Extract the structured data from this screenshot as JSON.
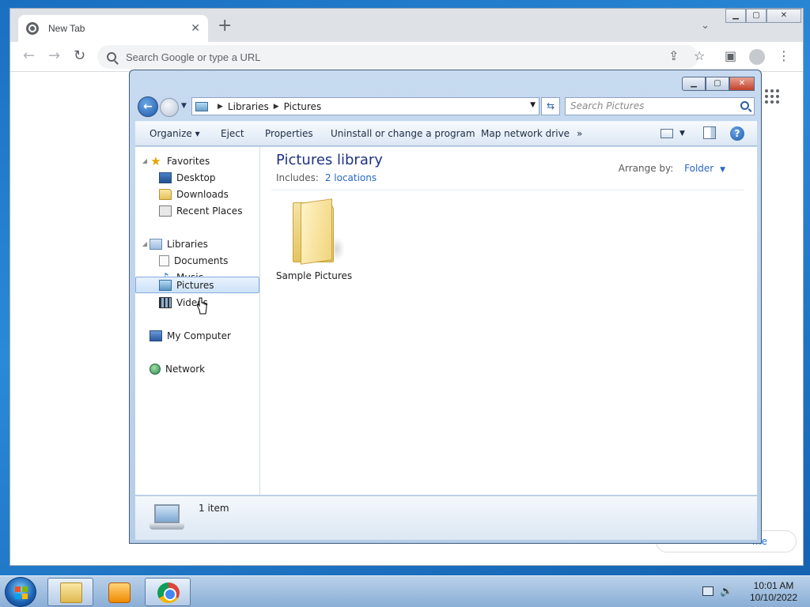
{
  "browser": {
    "tab_title": "New Tab",
    "tab_close": "✕",
    "new_tab": "+",
    "tab_search": "⌄",
    "omnibox_placeholder": "Search Google or type a URL",
    "back": "←",
    "forward": "→",
    "reload": "↻",
    "share": "⇪",
    "bookmark": "☆",
    "sidepanel": "▣",
    "menu": "⋮",
    "customize_fragment": "me",
    "window_controls": {
      "minimize": "▁",
      "maximize": "▢",
      "close": "✕"
    }
  },
  "explorer": {
    "window_controls": {
      "minimize": "▁",
      "maximize": "▢",
      "close": "✕"
    },
    "nav": {
      "back": "←",
      "history": "▼"
    },
    "breadcrumb": [
      "Libraries",
      "Pictures"
    ],
    "breadcrumb_sep": "▶",
    "address_dropdown": "▼",
    "refresh": "⇆",
    "search_placeholder": "Search Pictures",
    "command_bar": {
      "organize": "Organize ▾",
      "eject": "Eject",
      "properties": "Properties",
      "uninstall": "Uninstall or change a program",
      "map_drive": "Map network drive",
      "more": "»",
      "views_dropdown": "▼",
      "help": "?"
    },
    "nav_pane": {
      "favorites": "Favorites",
      "desktop": "Desktop",
      "downloads": "Downloads",
      "recent_places": "Recent Places",
      "libraries": "Libraries",
      "documents": "Documents",
      "music": "Music",
      "pictures": "Pictures",
      "videos": "Videos",
      "my_computer": "My Computer",
      "network": "Network"
    },
    "library": {
      "title": "Pictures library",
      "includes_label": "Includes:",
      "includes_link": "2 locations",
      "arrange_label": "Arrange by:",
      "arrange_value": "Folder",
      "arrange_dropdown": "▼"
    },
    "items": [
      {
        "name": "Sample Pictures"
      }
    ],
    "status": {
      "count": "1 item"
    }
  },
  "taskbar": {
    "time": "10:01 AM",
    "date": "10/10/2022",
    "volume_icon": "🔊"
  },
  "colors": {
    "library_title": "#1e3287",
    "link": "#2767c9",
    "selection_border": "#84acdd"
  }
}
